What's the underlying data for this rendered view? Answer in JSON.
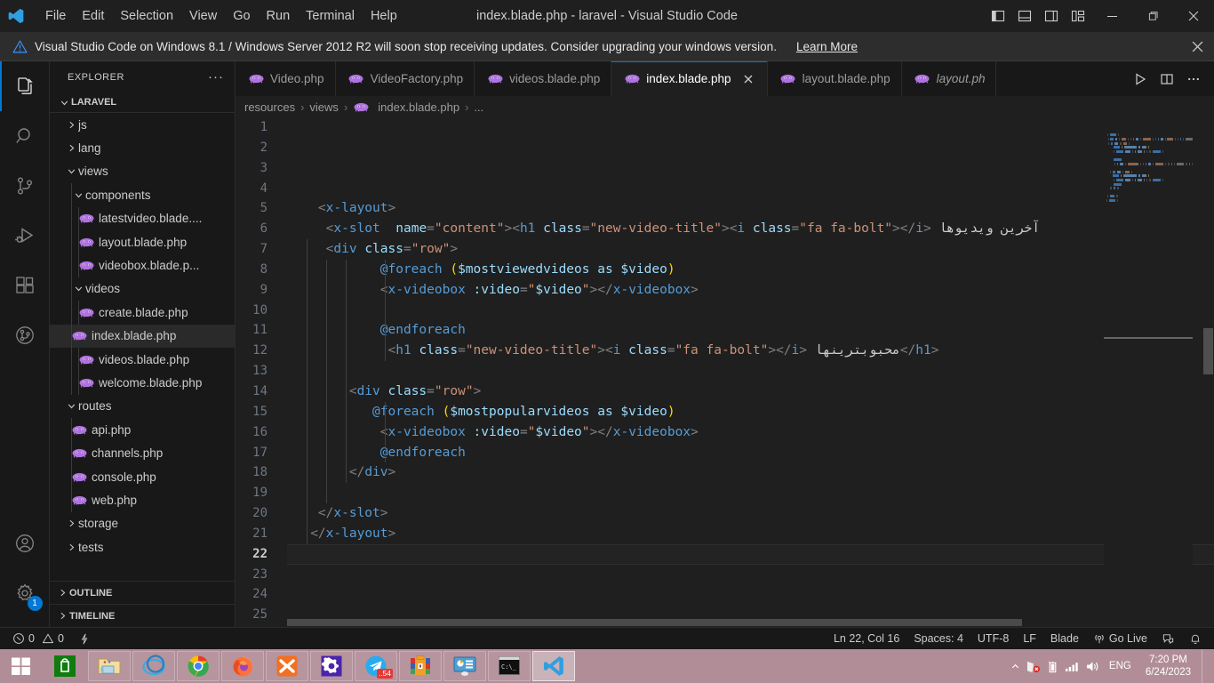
{
  "titlebar": {
    "menu": [
      "File",
      "Edit",
      "Selection",
      "View",
      "Go",
      "Run",
      "Terminal",
      "Help"
    ],
    "window_title": "index.blade.php - laravel - Visual Studio Code",
    "layout_icons": [
      "toggle-primary-sidebar-icon",
      "toggle-panel-icon",
      "toggle-secondary-sidebar-icon",
      "customize-layout-icon"
    ],
    "minimize_label": "–",
    "maximize_label": "❐",
    "close_label": "✕"
  },
  "banner": {
    "message": "Visual Studio Code on Windows 8.1 / Windows Server 2012 R2 will soon stop receiving updates. Consider upgrading your windows version.",
    "link": "Learn More",
    "close": "✕"
  },
  "activitybar": {
    "items": [
      {
        "name": "explorer",
        "icon": "files-icon",
        "active": true
      },
      {
        "name": "search",
        "icon": "search-icon",
        "active": false
      },
      {
        "name": "source-control",
        "icon": "source-control-icon",
        "active": false
      },
      {
        "name": "run-and-debug",
        "icon": "run-debug-icon",
        "active": false
      },
      {
        "name": "extensions",
        "icon": "extensions-icon",
        "active": false
      },
      {
        "name": "gitlens",
        "icon": "gitlens-icon",
        "active": false
      }
    ],
    "bottom": [
      {
        "name": "accounts",
        "icon": "account-icon",
        "badge": ""
      },
      {
        "name": "manage",
        "icon": "gear-icon",
        "badge": "1"
      }
    ]
  },
  "sidebar": {
    "title": "EXPLORER",
    "more_actions": "···",
    "root": "LARAVEL",
    "tree": [
      {
        "label": "js",
        "indent": 1,
        "type": "folder",
        "state": "collapsed"
      },
      {
        "label": "lang",
        "indent": 1,
        "type": "folder",
        "state": "collapsed"
      },
      {
        "label": "views",
        "indent": 1,
        "type": "folder",
        "state": "expanded"
      },
      {
        "label": "components",
        "indent": 2,
        "type": "folder",
        "state": "expanded"
      },
      {
        "label": "latestvideo.blade....",
        "indent": 3,
        "type": "php"
      },
      {
        "label": "layout.blade.php",
        "indent": 3,
        "type": "php"
      },
      {
        "label": "videobox.blade.p...",
        "indent": 3,
        "type": "php"
      },
      {
        "label": "videos",
        "indent": 2,
        "type": "folder",
        "state": "expanded"
      },
      {
        "label": "create.blade.php",
        "indent": 3,
        "type": "php"
      },
      {
        "label": "index.blade.php",
        "indent": 2,
        "type": "php",
        "selected": true
      },
      {
        "label": "videos.blade.php",
        "indent": 3,
        "type": "php"
      },
      {
        "label": "welcome.blade.php",
        "indent": 3,
        "type": "php"
      },
      {
        "label": "routes",
        "indent": 1,
        "type": "folder",
        "state": "expanded"
      },
      {
        "label": "api.php",
        "indent": 2,
        "type": "php"
      },
      {
        "label": "channels.php",
        "indent": 2,
        "type": "php"
      },
      {
        "label": "console.php",
        "indent": 2,
        "type": "php"
      },
      {
        "label": "web.php",
        "indent": 2,
        "type": "php"
      },
      {
        "label": "storage",
        "indent": 1,
        "type": "folder",
        "state": "collapsed"
      },
      {
        "label": "tests",
        "indent": 1,
        "type": "folder",
        "state": "collapsed"
      }
    ],
    "bottom_sections": [
      "OUTLINE",
      "TIMELINE"
    ]
  },
  "tabs": [
    {
      "label": "Video.php",
      "active": false,
      "preview": false,
      "closable": false
    },
    {
      "label": "VideoFactory.php",
      "active": false,
      "preview": false,
      "closable": false
    },
    {
      "label": "videos.blade.php",
      "active": false,
      "preview": false,
      "closable": false
    },
    {
      "label": "index.blade.php",
      "active": true,
      "preview": false,
      "closable": true
    },
    {
      "label": "layout.blade.php",
      "active": false,
      "preview": false,
      "closable": false
    },
    {
      "label": "layout.ph",
      "active": false,
      "preview": true,
      "closable": false
    }
  ],
  "tab_actions": [
    "run-icon",
    "split-editor-icon",
    "more-actions-icon"
  ],
  "breadcrumb": [
    "resources",
    "views",
    "index.blade.php",
    "..."
  ],
  "editor": {
    "first_line": 1,
    "last_line": 25,
    "current_line": 22,
    "lines": [
      {
        "n": 1,
        "tokens": []
      },
      {
        "n": 2,
        "tokens": []
      },
      {
        "n": 3,
        "tokens": []
      },
      {
        "n": 4,
        "tokens": []
      },
      {
        "n": 5,
        "tokens": [
          {
            "t": "plain",
            "s": "    "
          },
          {
            "t": "br",
            "s": "<"
          },
          {
            "t": "tag",
            "s": "x-layout"
          },
          {
            "t": "br",
            "s": ">"
          }
        ]
      },
      {
        "n": 6,
        "tokens": [
          {
            "t": "plain",
            "s": "     "
          },
          {
            "t": "br",
            "s": "<"
          },
          {
            "t": "tag",
            "s": "x-slot"
          },
          {
            "t": "plain",
            "s": "  "
          },
          {
            "t": "attr",
            "s": "name"
          },
          {
            "t": "br",
            "s": "="
          },
          {
            "t": "str",
            "s": "\"content\""
          },
          {
            "t": "br",
            "s": ">"
          },
          {
            "t": "br",
            "s": "<"
          },
          {
            "t": "tag",
            "s": "h1"
          },
          {
            "t": "plain",
            "s": " "
          },
          {
            "t": "attr",
            "s": "class"
          },
          {
            "t": "br",
            "s": "="
          },
          {
            "t": "str",
            "s": "\"new-video-title\""
          },
          {
            "t": "br",
            "s": ">"
          },
          {
            "t": "br",
            "s": "<"
          },
          {
            "t": "tag",
            "s": "i"
          },
          {
            "t": "plain",
            "s": " "
          },
          {
            "t": "attr",
            "s": "class"
          },
          {
            "t": "br",
            "s": "="
          },
          {
            "t": "str",
            "s": "\"fa fa-bolt\""
          },
          {
            "t": "br",
            "s": ">"
          },
          {
            "t": "br",
            "s": "</"
          },
          {
            "t": "tag",
            "s": "i"
          },
          {
            "t": "br",
            "s": ">"
          },
          {
            "t": "text",
            "s": " آخرین ویدیوها"
          }
        ]
      },
      {
        "n": 7,
        "tokens": [
          {
            "t": "plain",
            "s": "     "
          },
          {
            "t": "br",
            "s": "<"
          },
          {
            "t": "tag",
            "s": "div"
          },
          {
            "t": "plain",
            "s": " "
          },
          {
            "t": "attr",
            "s": "class"
          },
          {
            "t": "br",
            "s": "="
          },
          {
            "t": "str",
            "s": "\"row\""
          },
          {
            "t": "br",
            "s": ">"
          }
        ]
      },
      {
        "n": 8,
        "tokens": [
          {
            "t": "plain",
            "s": "            "
          },
          {
            "t": "dir",
            "s": "@foreach"
          },
          {
            "t": "plain",
            "s": " "
          },
          {
            "t": "paren",
            "s": "("
          },
          {
            "t": "var",
            "s": "$mostviewedvideos"
          },
          {
            "t": "plain",
            "s": " "
          },
          {
            "t": "attr",
            "s": "as"
          },
          {
            "t": "plain",
            "s": " "
          },
          {
            "t": "var",
            "s": "$video"
          },
          {
            "t": "paren",
            "s": ")"
          }
        ]
      },
      {
        "n": 9,
        "tokens": [
          {
            "t": "plain",
            "s": "            "
          },
          {
            "t": "br",
            "s": "<"
          },
          {
            "t": "tag",
            "s": "x-videobox"
          },
          {
            "t": "plain",
            "s": " "
          },
          {
            "t": "attr",
            "s": ":video"
          },
          {
            "t": "br",
            "s": "="
          },
          {
            "t": "str",
            "s": "\""
          },
          {
            "t": "var",
            "s": "$video"
          },
          {
            "t": "str",
            "s": "\""
          },
          {
            "t": "br",
            "s": ">"
          },
          {
            "t": "br",
            "s": "</"
          },
          {
            "t": "tag",
            "s": "x-videobox"
          },
          {
            "t": "br",
            "s": ">"
          }
        ]
      },
      {
        "n": 10,
        "tokens": []
      },
      {
        "n": 11,
        "tokens": [
          {
            "t": "plain",
            "s": "            "
          },
          {
            "t": "dir",
            "s": "@endforeach"
          }
        ]
      },
      {
        "n": 12,
        "tokens": [
          {
            "t": "plain",
            "s": "             "
          },
          {
            "t": "br",
            "s": "<"
          },
          {
            "t": "tag",
            "s": "h1"
          },
          {
            "t": "plain",
            "s": " "
          },
          {
            "t": "attr",
            "s": "class"
          },
          {
            "t": "br",
            "s": "="
          },
          {
            "t": "str",
            "s": "\"new-video-title\""
          },
          {
            "t": "br",
            "s": ">"
          },
          {
            "t": "br",
            "s": "<"
          },
          {
            "t": "tag",
            "s": "i"
          },
          {
            "t": "plain",
            "s": " "
          },
          {
            "t": "attr",
            "s": "class"
          },
          {
            "t": "br",
            "s": "="
          },
          {
            "t": "str",
            "s": "\"fa fa-bolt\""
          },
          {
            "t": "br",
            "s": ">"
          },
          {
            "t": "br",
            "s": "</"
          },
          {
            "t": "tag",
            "s": "i"
          },
          {
            "t": "br",
            "s": ">"
          },
          {
            "t": "text",
            "s": " محبوبترینها"
          },
          {
            "t": "br",
            "s": "</"
          },
          {
            "t": "tag",
            "s": "h1"
          },
          {
            "t": "br",
            "s": ">"
          }
        ]
      },
      {
        "n": 13,
        "tokens": []
      },
      {
        "n": 14,
        "tokens": [
          {
            "t": "plain",
            "s": "        "
          },
          {
            "t": "br",
            "s": "<"
          },
          {
            "t": "tag",
            "s": "div"
          },
          {
            "t": "plain",
            "s": " "
          },
          {
            "t": "attr",
            "s": "class"
          },
          {
            "t": "br",
            "s": "="
          },
          {
            "t": "str",
            "s": "\"row\""
          },
          {
            "t": "br",
            "s": ">"
          }
        ]
      },
      {
        "n": 15,
        "tokens": [
          {
            "t": "plain",
            "s": "           "
          },
          {
            "t": "dir",
            "s": "@foreach"
          },
          {
            "t": "plain",
            "s": " "
          },
          {
            "t": "paren",
            "s": "("
          },
          {
            "t": "var",
            "s": "$mostpopularvideos"
          },
          {
            "t": "plain",
            "s": " "
          },
          {
            "t": "attr",
            "s": "as"
          },
          {
            "t": "plain",
            "s": " "
          },
          {
            "t": "var",
            "s": "$video"
          },
          {
            "t": "paren",
            "s": ")"
          }
        ]
      },
      {
        "n": 16,
        "tokens": [
          {
            "t": "plain",
            "s": "            "
          },
          {
            "t": "br",
            "s": "<"
          },
          {
            "t": "tag",
            "s": "x-videobox"
          },
          {
            "t": "plain",
            "s": " "
          },
          {
            "t": "attr",
            "s": ":video"
          },
          {
            "t": "br",
            "s": "="
          },
          {
            "t": "str",
            "s": "\""
          },
          {
            "t": "var",
            "s": "$video"
          },
          {
            "t": "str",
            "s": "\""
          },
          {
            "t": "br",
            "s": ">"
          },
          {
            "t": "br",
            "s": "</"
          },
          {
            "t": "tag",
            "s": "x-videobox"
          },
          {
            "t": "br",
            "s": ">"
          }
        ]
      },
      {
        "n": 17,
        "tokens": [
          {
            "t": "plain",
            "s": "            "
          },
          {
            "t": "dir",
            "s": "@endforeach"
          }
        ]
      },
      {
        "n": 18,
        "tokens": [
          {
            "t": "plain",
            "s": "        "
          },
          {
            "t": "br",
            "s": "</"
          },
          {
            "t": "tag",
            "s": "div"
          },
          {
            "t": "br",
            "s": ">"
          }
        ]
      },
      {
        "n": 19,
        "tokens": []
      },
      {
        "n": 20,
        "tokens": [
          {
            "t": "plain",
            "s": "    "
          },
          {
            "t": "br",
            "s": "</"
          },
          {
            "t": "tag",
            "s": "x-slot"
          },
          {
            "t": "br",
            "s": ">"
          }
        ]
      },
      {
        "n": 21,
        "tokens": [
          {
            "t": "plain",
            "s": "   "
          },
          {
            "t": "br",
            "s": "</"
          },
          {
            "t": "tag",
            "s": "x-layout"
          },
          {
            "t": "br",
            "s": ">"
          }
        ]
      },
      {
        "n": 22,
        "tokens": []
      },
      {
        "n": 23,
        "tokens": []
      },
      {
        "n": 24,
        "tokens": []
      },
      {
        "n": 25,
        "tokens": []
      }
    ]
  },
  "statusbar": {
    "errors": "0",
    "warnings": "0",
    "cursor": "Ln 22, Col 16",
    "indent": "Spaces: 4",
    "encoding": "UTF-8",
    "eol": "LF",
    "language": "Blade",
    "golive": "Go Live",
    "remote_icon": "remote-window-icon",
    "bell_icon": "bell-icon",
    "ports_icon": "ports-icon"
  },
  "taskbar": {
    "start": "windows-start-icon",
    "items": [
      {
        "name": "microsoft-store",
        "icon": "store-icon",
        "active": false,
        "pinned": true
      },
      {
        "name": "file-explorer",
        "icon": "folder-icon",
        "active": false
      },
      {
        "name": "internet-explorer",
        "icon": "ie-icon",
        "active": false
      },
      {
        "name": "google-chrome",
        "icon": "chrome-icon",
        "active": false
      },
      {
        "name": "firefox",
        "icon": "firefox-icon",
        "active": false
      },
      {
        "name": "xampp",
        "icon": "xampp-icon",
        "active": false
      },
      {
        "name": "settings",
        "icon": "settings-icon",
        "active": false
      },
      {
        "name": "telegram",
        "icon": "telegram-icon",
        "active": false,
        "badge": "..54"
      },
      {
        "name": "winrar",
        "icon": "winrar-icon",
        "active": false
      },
      {
        "name": "control-panel",
        "icon": "control-panel-icon",
        "active": false
      },
      {
        "name": "command-prompt",
        "icon": "cmd-icon",
        "active": false
      },
      {
        "name": "visual-studio-code",
        "icon": "vscode-icon",
        "active": true
      }
    ],
    "tray": {
      "overflow": "▲",
      "network": "network-error-icon",
      "battery": "battery-icon",
      "signal": "signal-icon",
      "volume": "volume-icon",
      "language": "ENG",
      "time": "7:20 PM",
      "date": "6/24/2023"
    }
  }
}
